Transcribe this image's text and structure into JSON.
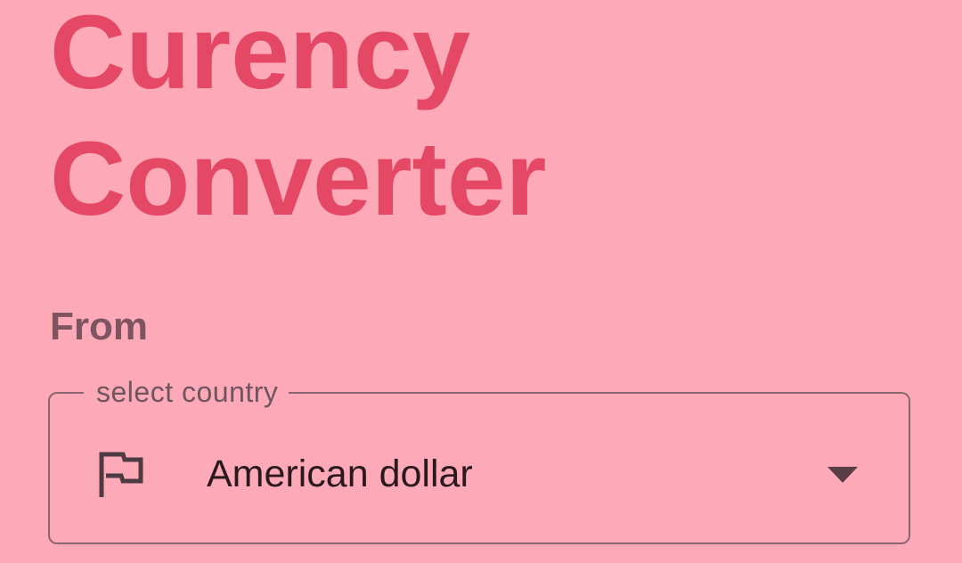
{
  "header": {
    "title_line1": "Curency",
    "title_line2": "Converter"
  },
  "from_section": {
    "label": "From",
    "select": {
      "legend": "select country",
      "value": "American dollar",
      "leading_icon": "flag-icon",
      "trailing_icon": "dropdown-arrow-icon"
    }
  },
  "colors": {
    "background": "#FDA9B7",
    "title": "#E54865",
    "label": "#7E5460",
    "outline": "#8A6670",
    "text": "#2A1A20"
  }
}
